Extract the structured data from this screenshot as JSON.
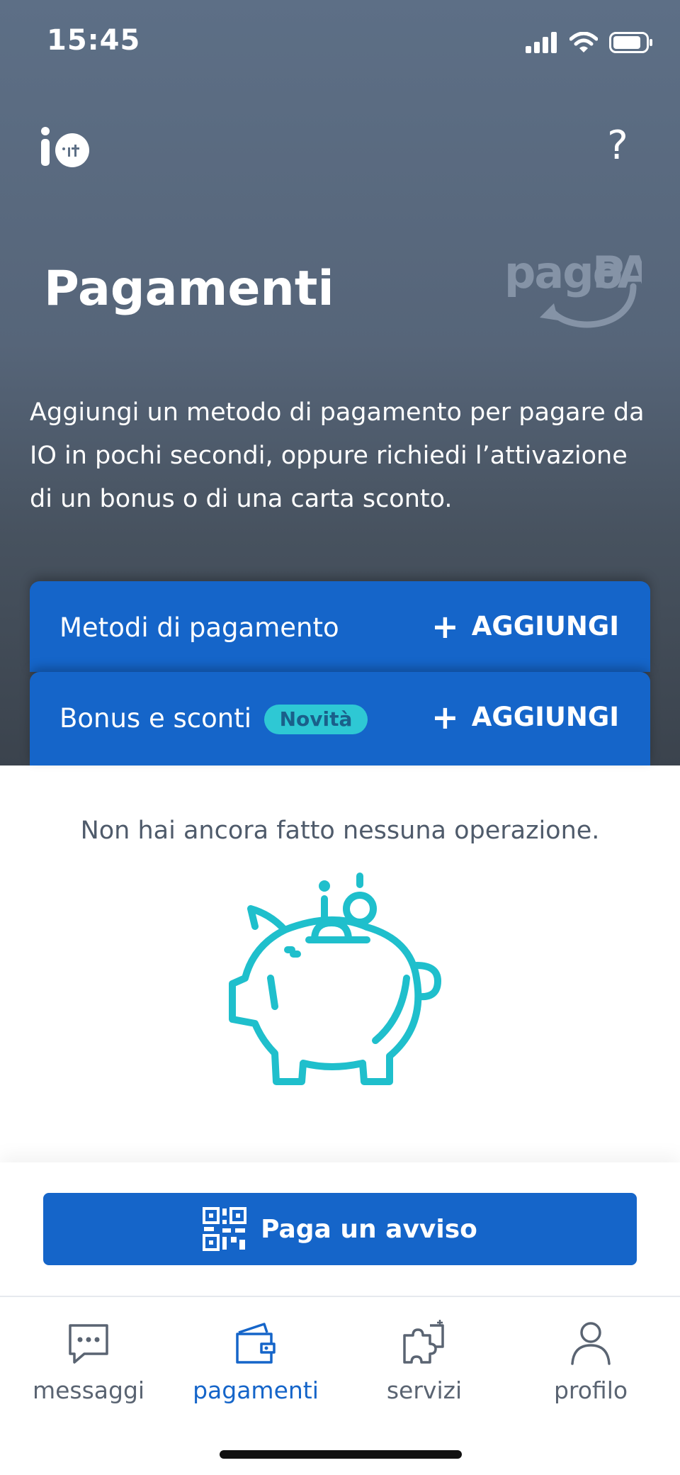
{
  "status_bar": {
    "time": "15:45"
  },
  "header": {
    "title": "Pagamenti",
    "intro": "Aggiungi un metodo di pagamento per pagare da IO in pochi secondi, oppure richiedi l’attivazione di un bonus o di una carta sconto."
  },
  "cards": {
    "metodi": {
      "label": "Metodi di pagamento",
      "action": "AGGIUNGI"
    },
    "bonus": {
      "label": "Bonus e sconti",
      "badge": "Novità",
      "action": "AGGIUNGI"
    }
  },
  "empty_state": {
    "message": "Non hai ancora fatto nessuna operazione."
  },
  "pay_button": {
    "label": "Paga un avviso"
  },
  "tabbar": {
    "items": [
      {
        "label": "messaggi",
        "icon": "chat-icon"
      },
      {
        "label": "pagamenti",
        "icon": "wallet-icon",
        "active": true
      },
      {
        "label": "servizi",
        "icon": "puzzle-icon"
      },
      {
        "label": "profilo",
        "icon": "user-icon"
      }
    ]
  },
  "colors": {
    "primary": "#1565c9",
    "accent": "#2ec8d4",
    "header_top": "#5d6f86",
    "header_bottom": "#3b434d",
    "text_muted": "#5a6472"
  }
}
